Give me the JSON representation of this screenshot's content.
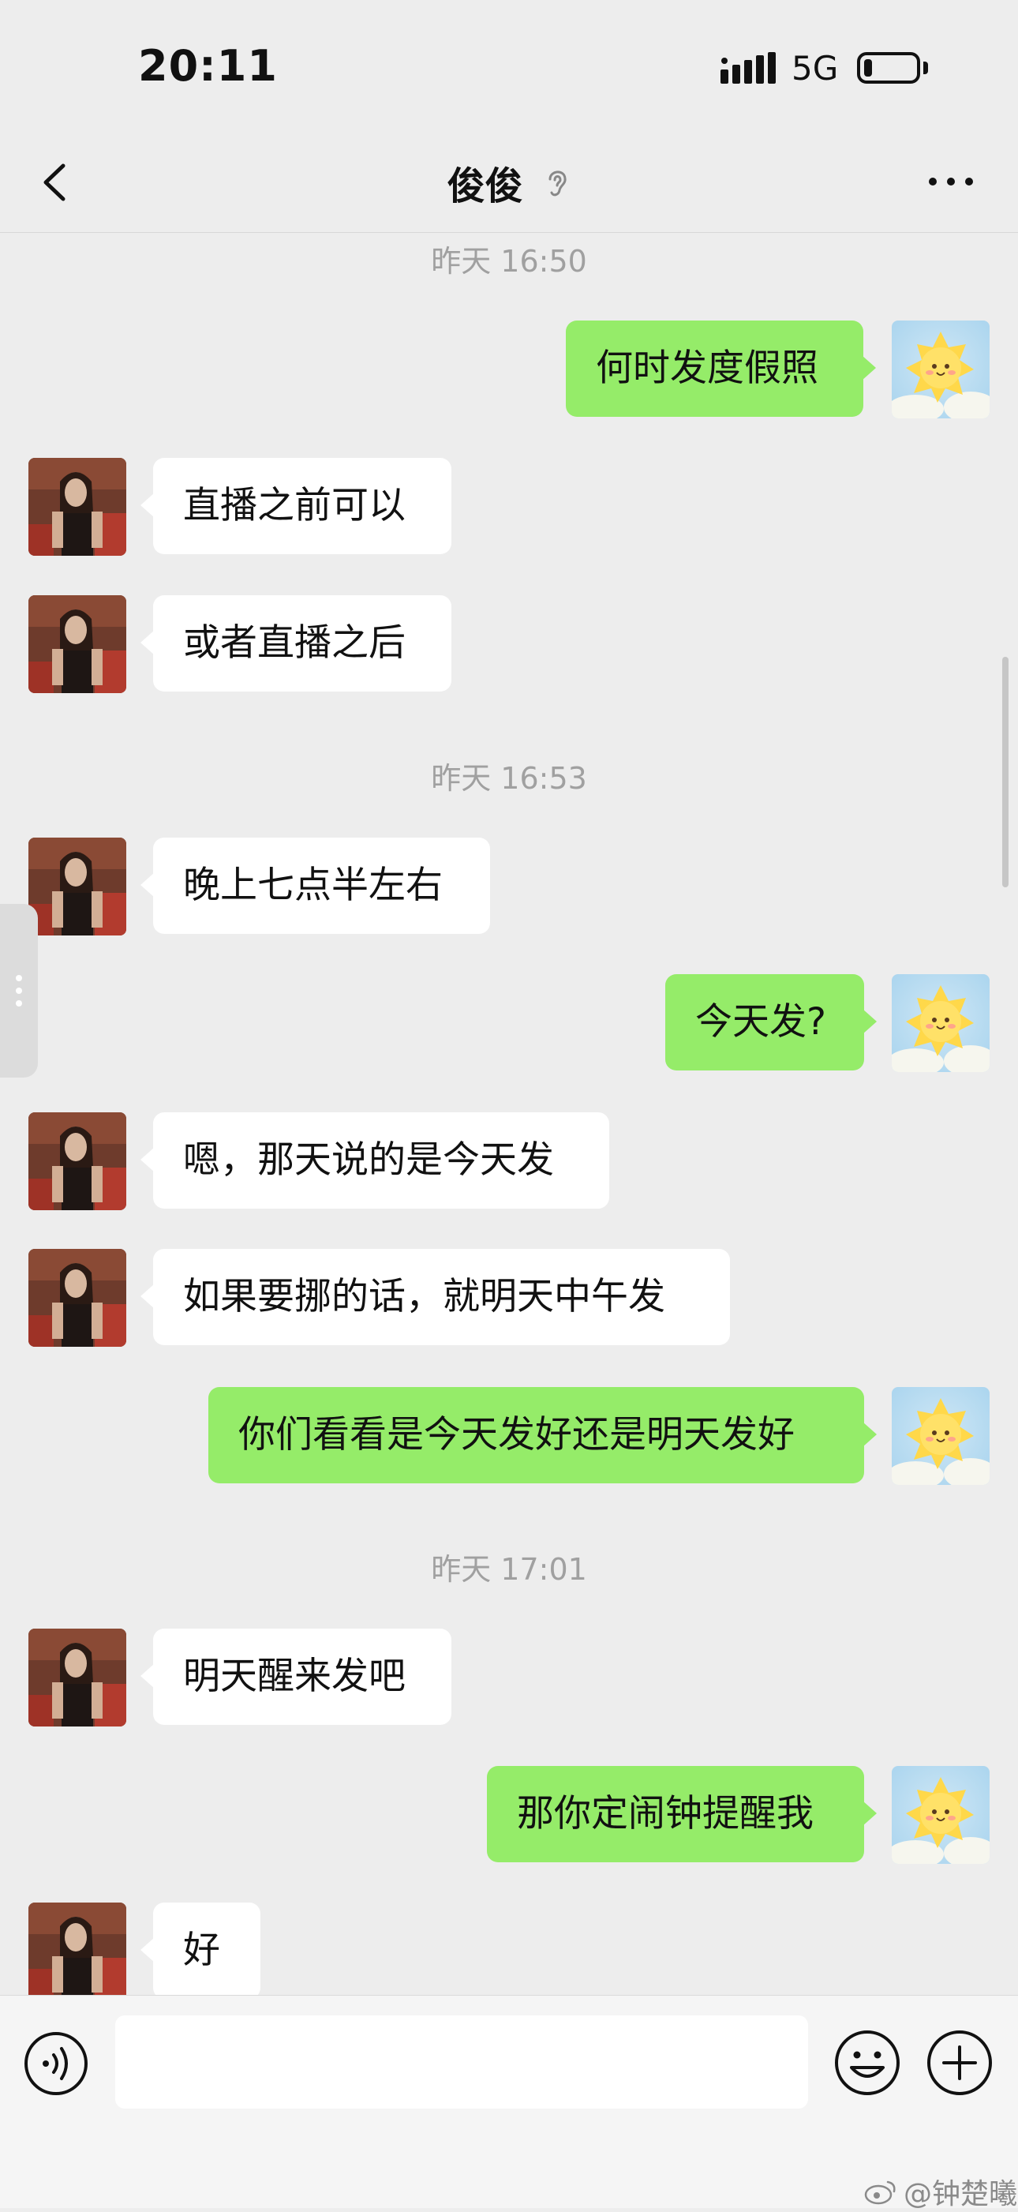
{
  "status_bar": {
    "time": "20:11",
    "network": "5G"
  },
  "header": {
    "title": "俊俊",
    "back_icon": "chevron-left-icon",
    "more_icon": "ellipsis-icon",
    "mute_icon": "ear-icon"
  },
  "chat": {
    "timestamps": [
      "昨天 16:50",
      "昨天 16:53",
      "昨天 17:01"
    ],
    "messages": [
      {
        "side": "out",
        "text": "何时发度假照"
      },
      {
        "side": "in",
        "text": "直播之前可以"
      },
      {
        "side": "in",
        "text": "或者直播之后"
      },
      {
        "side": "in",
        "text": "晚上七点半左右"
      },
      {
        "side": "out",
        "text": "今天发?"
      },
      {
        "side": "in",
        "text": "嗯，那天说的是今天发"
      },
      {
        "side": "in",
        "text": "如果要挪的话，就明天中午发"
      },
      {
        "side": "out",
        "text": "你们看看是今天发好还是明天发好"
      },
      {
        "side": "in",
        "text": "明天醒来发吧"
      },
      {
        "side": "out",
        "text": "那你定闹钟提醒我"
      },
      {
        "side": "in",
        "text": "好"
      }
    ]
  },
  "input_bar": {
    "placeholder": "",
    "voice_icon": "voice-icon",
    "emoji_icon": "emoji-icon",
    "plus_icon": "plus-icon"
  },
  "watermark": {
    "text": "@钟楚曦"
  },
  "colors": {
    "background": "#ededed",
    "outgoing_bubble": "#95ec69",
    "incoming_bubble": "#ffffff",
    "timestamp": "#a0a0a0"
  }
}
